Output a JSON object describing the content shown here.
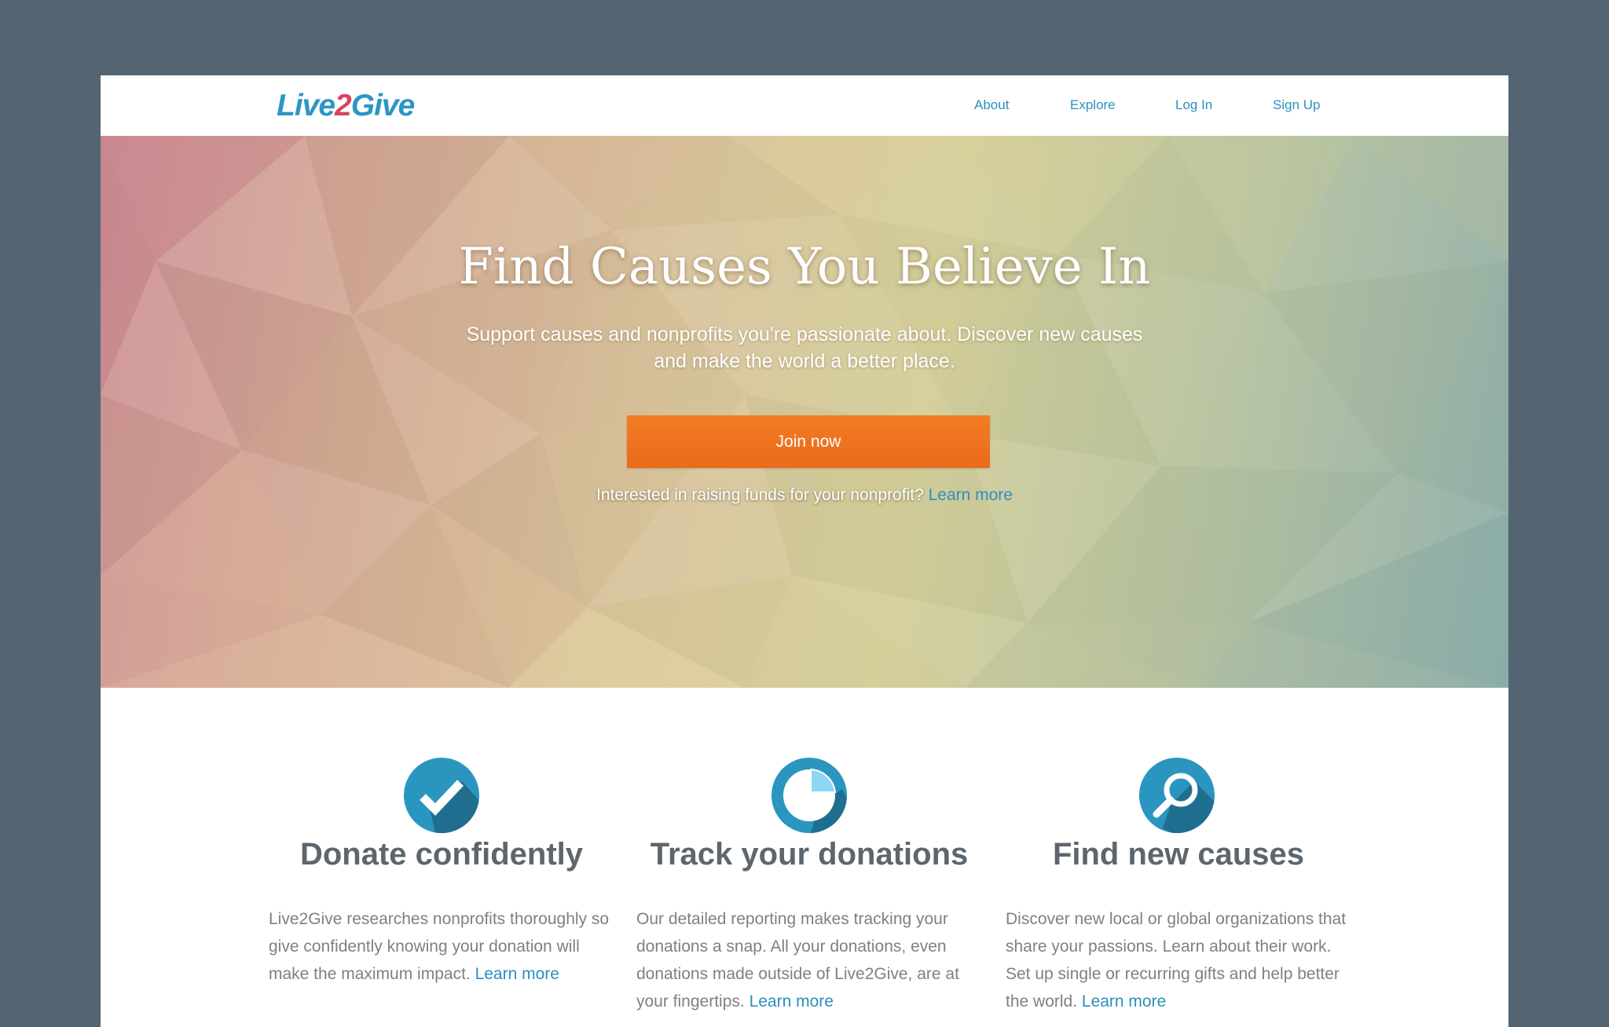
{
  "brand": {
    "name_part1": "Live",
    "name_part2": "2",
    "name_part3": "Give",
    "color_primary": "#2c96c4",
    "color_accent": "#d8465d"
  },
  "nav": {
    "items": [
      {
        "label": "About"
      },
      {
        "label": "Explore"
      },
      {
        "label": "Log In"
      },
      {
        "label": "Sign Up"
      }
    ]
  },
  "hero": {
    "title": "Find Causes You Believe In",
    "subtitle": "Support causes and nonprofits you're passionate about. Discover new causes and make the world a better place.",
    "cta_label": "Join now",
    "cta_color": "#ef7320",
    "note_text": "Interested in raising funds for your nonprofit? ",
    "note_link": "Learn more"
  },
  "features": [
    {
      "icon": "checkmark-icon",
      "title": "Donate confidently",
      "body": "Live2Give researches nonprofits thoroughly so give confidently knowing your donation will make the maximum impact. ",
      "link": "Learn more"
    },
    {
      "icon": "pie-chart-icon",
      "title": "Track your donations",
      "body": "Our detailed reporting makes tracking your donations a snap. All your donations, even donations made outside of Live2Give, are at your fingertips. ",
      "link": "Learn more"
    },
    {
      "icon": "magnifier-icon",
      "title": "Find new causes",
      "body": "Discover new local or global organizations that share your passions. Learn about their work. Set up single or recurring gifts and help better the world. ",
      "link": "Learn more"
    }
  ]
}
